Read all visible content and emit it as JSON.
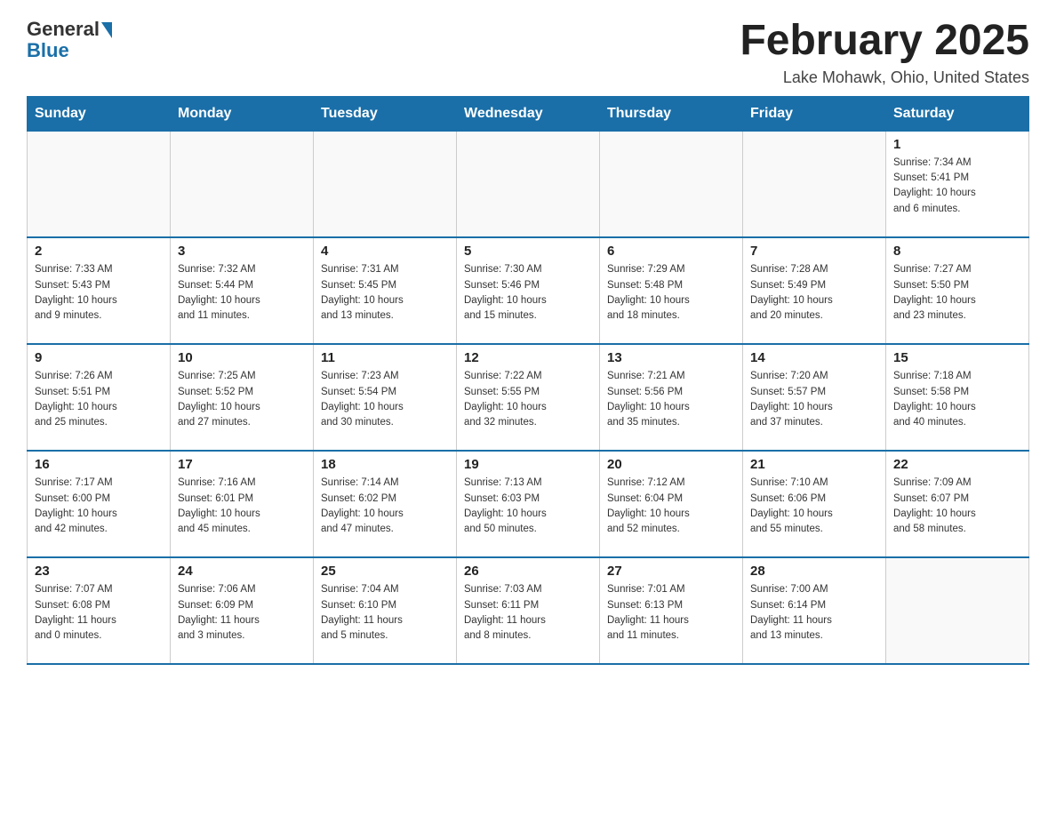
{
  "header": {
    "logo_general": "General",
    "logo_blue": "Blue",
    "month_title": "February 2025",
    "location": "Lake Mohawk, Ohio, United States"
  },
  "weekdays": [
    "Sunday",
    "Monday",
    "Tuesday",
    "Wednesday",
    "Thursday",
    "Friday",
    "Saturday"
  ],
  "weeks": [
    [
      {
        "day": "",
        "info": ""
      },
      {
        "day": "",
        "info": ""
      },
      {
        "day": "",
        "info": ""
      },
      {
        "day": "",
        "info": ""
      },
      {
        "day": "",
        "info": ""
      },
      {
        "day": "",
        "info": ""
      },
      {
        "day": "1",
        "info": "Sunrise: 7:34 AM\nSunset: 5:41 PM\nDaylight: 10 hours\nand 6 minutes."
      }
    ],
    [
      {
        "day": "2",
        "info": "Sunrise: 7:33 AM\nSunset: 5:43 PM\nDaylight: 10 hours\nand 9 minutes."
      },
      {
        "day": "3",
        "info": "Sunrise: 7:32 AM\nSunset: 5:44 PM\nDaylight: 10 hours\nand 11 minutes."
      },
      {
        "day": "4",
        "info": "Sunrise: 7:31 AM\nSunset: 5:45 PM\nDaylight: 10 hours\nand 13 minutes."
      },
      {
        "day": "5",
        "info": "Sunrise: 7:30 AM\nSunset: 5:46 PM\nDaylight: 10 hours\nand 15 minutes."
      },
      {
        "day": "6",
        "info": "Sunrise: 7:29 AM\nSunset: 5:48 PM\nDaylight: 10 hours\nand 18 minutes."
      },
      {
        "day": "7",
        "info": "Sunrise: 7:28 AM\nSunset: 5:49 PM\nDaylight: 10 hours\nand 20 minutes."
      },
      {
        "day": "8",
        "info": "Sunrise: 7:27 AM\nSunset: 5:50 PM\nDaylight: 10 hours\nand 23 minutes."
      }
    ],
    [
      {
        "day": "9",
        "info": "Sunrise: 7:26 AM\nSunset: 5:51 PM\nDaylight: 10 hours\nand 25 minutes."
      },
      {
        "day": "10",
        "info": "Sunrise: 7:25 AM\nSunset: 5:52 PM\nDaylight: 10 hours\nand 27 minutes."
      },
      {
        "day": "11",
        "info": "Sunrise: 7:23 AM\nSunset: 5:54 PM\nDaylight: 10 hours\nand 30 minutes."
      },
      {
        "day": "12",
        "info": "Sunrise: 7:22 AM\nSunset: 5:55 PM\nDaylight: 10 hours\nand 32 minutes."
      },
      {
        "day": "13",
        "info": "Sunrise: 7:21 AM\nSunset: 5:56 PM\nDaylight: 10 hours\nand 35 minutes."
      },
      {
        "day": "14",
        "info": "Sunrise: 7:20 AM\nSunset: 5:57 PM\nDaylight: 10 hours\nand 37 minutes."
      },
      {
        "day": "15",
        "info": "Sunrise: 7:18 AM\nSunset: 5:58 PM\nDaylight: 10 hours\nand 40 minutes."
      }
    ],
    [
      {
        "day": "16",
        "info": "Sunrise: 7:17 AM\nSunset: 6:00 PM\nDaylight: 10 hours\nand 42 minutes."
      },
      {
        "day": "17",
        "info": "Sunrise: 7:16 AM\nSunset: 6:01 PM\nDaylight: 10 hours\nand 45 minutes."
      },
      {
        "day": "18",
        "info": "Sunrise: 7:14 AM\nSunset: 6:02 PM\nDaylight: 10 hours\nand 47 minutes."
      },
      {
        "day": "19",
        "info": "Sunrise: 7:13 AM\nSunset: 6:03 PM\nDaylight: 10 hours\nand 50 minutes."
      },
      {
        "day": "20",
        "info": "Sunrise: 7:12 AM\nSunset: 6:04 PM\nDaylight: 10 hours\nand 52 minutes."
      },
      {
        "day": "21",
        "info": "Sunrise: 7:10 AM\nSunset: 6:06 PM\nDaylight: 10 hours\nand 55 minutes."
      },
      {
        "day": "22",
        "info": "Sunrise: 7:09 AM\nSunset: 6:07 PM\nDaylight: 10 hours\nand 58 minutes."
      }
    ],
    [
      {
        "day": "23",
        "info": "Sunrise: 7:07 AM\nSunset: 6:08 PM\nDaylight: 11 hours\nand 0 minutes."
      },
      {
        "day": "24",
        "info": "Sunrise: 7:06 AM\nSunset: 6:09 PM\nDaylight: 11 hours\nand 3 minutes."
      },
      {
        "day": "25",
        "info": "Sunrise: 7:04 AM\nSunset: 6:10 PM\nDaylight: 11 hours\nand 5 minutes."
      },
      {
        "day": "26",
        "info": "Sunrise: 7:03 AM\nSunset: 6:11 PM\nDaylight: 11 hours\nand 8 minutes."
      },
      {
        "day": "27",
        "info": "Sunrise: 7:01 AM\nSunset: 6:13 PM\nDaylight: 11 hours\nand 11 minutes."
      },
      {
        "day": "28",
        "info": "Sunrise: 7:00 AM\nSunset: 6:14 PM\nDaylight: 11 hours\nand 13 minutes."
      },
      {
        "day": "",
        "info": ""
      }
    ]
  ]
}
